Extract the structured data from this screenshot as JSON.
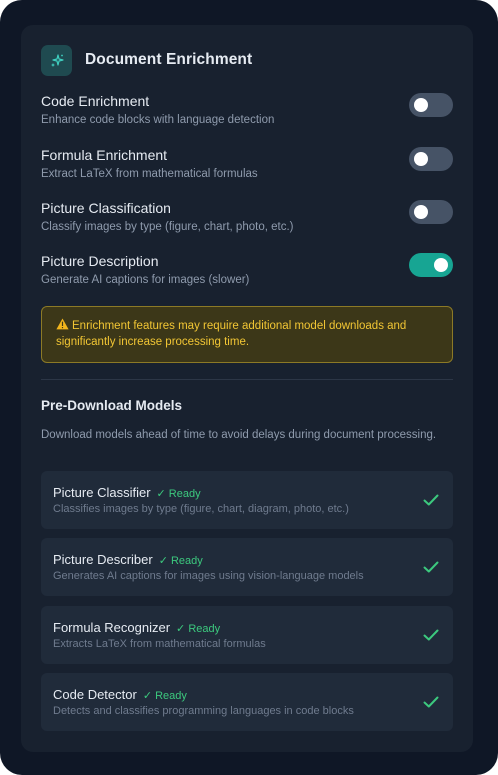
{
  "header": {
    "title": "Document Enrichment",
    "icon": "sparkles-icon"
  },
  "settings": [
    {
      "title": "Code Enrichment",
      "description": "Enhance code blocks with language detection",
      "enabled": false
    },
    {
      "title": "Formula Enrichment",
      "description": "Extract LaTeX from mathematical formulas",
      "enabled": false
    },
    {
      "title": "Picture Classification",
      "description": "Classify images by type (figure, chart, photo, etc.)",
      "enabled": false
    },
    {
      "title": "Picture Description",
      "description": "Generate AI captions for images (slower)",
      "enabled": true
    }
  ],
  "warning": {
    "icon": "warning-icon",
    "text": "Enrichment features may require additional model downloads and significantly increase processing time."
  },
  "models_section": {
    "title": "Pre-Download Models",
    "description": "Download models ahead of time to avoid delays during document processing."
  },
  "models": [
    {
      "name": "Picture Classifier",
      "status": "✓ Ready",
      "description": "Classifies images by type (figure, chart, diagram, photo, etc.)"
    },
    {
      "name": "Picture Describer",
      "status": "✓ Ready",
      "description": "Generates AI captions for images using vision-language models"
    },
    {
      "name": "Formula Recognizer",
      "status": "✓ Ready",
      "description": "Extracts LaTeX from mathematical formulas"
    },
    {
      "name": "Code Detector",
      "status": "✓ Ready",
      "description": "Detects and classifies programming languages in code blocks"
    }
  ],
  "colors": {
    "background": "#0f1726",
    "panel": "#18212f",
    "accent_teal": "#17a593",
    "toggle_off": "#465366",
    "warning_text": "#f2c634",
    "ready_green": "#3cc97e"
  }
}
